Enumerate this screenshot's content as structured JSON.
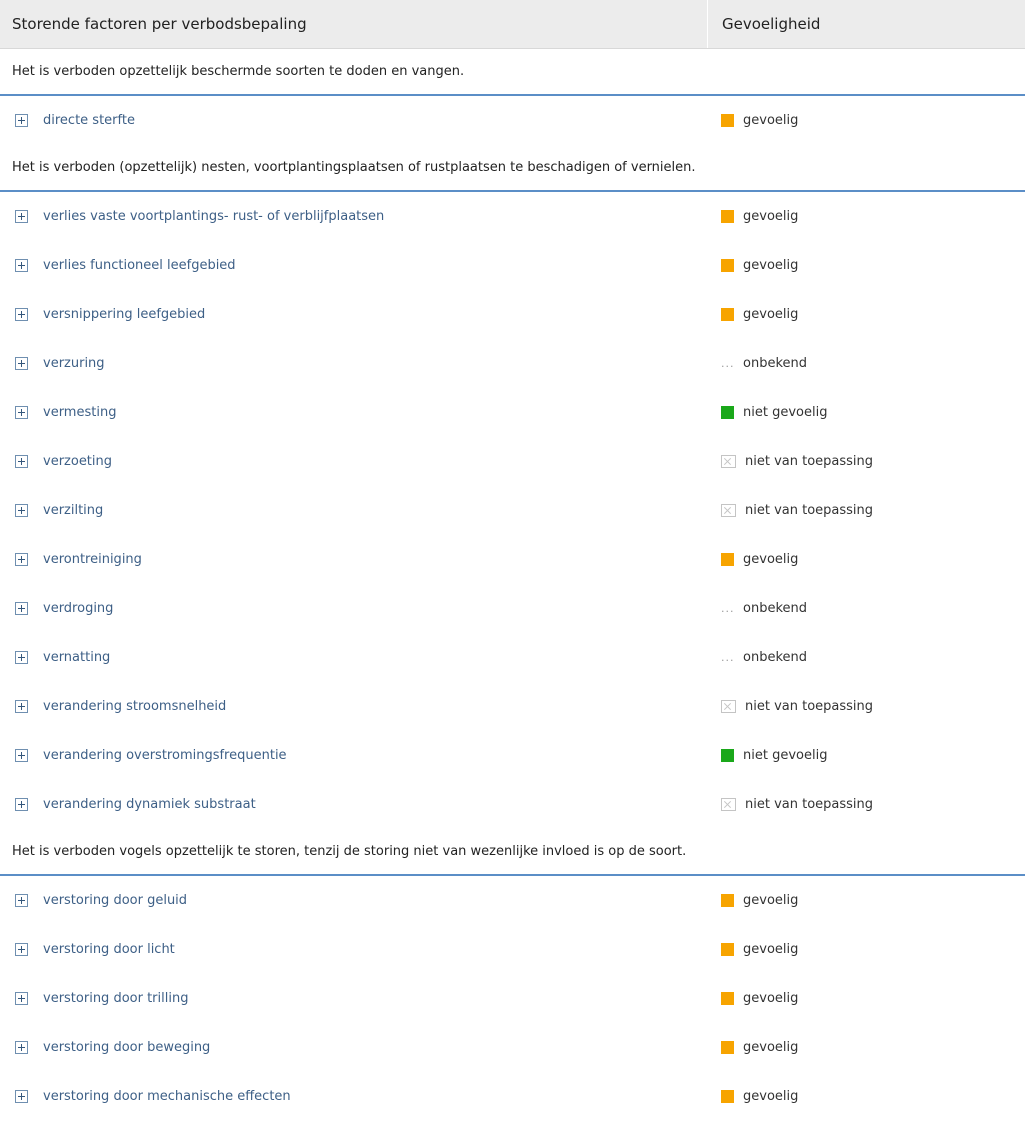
{
  "header": {
    "col_factor": "Storende factoren per verbodsbepaling",
    "col_sensitivity": "Gevoeligheid"
  },
  "legend_colors": {
    "gevoelig": "#f7a400",
    "niet_gevoelig": "#1aa81a"
  },
  "sections": [
    {
      "title": "Het is verboden opzettelijk beschermde soorten te doden en vangen.",
      "rows": [
        {
          "factor": "directe sterfte",
          "status": "gevoelig",
          "icon": "orange-square-icon"
        }
      ]
    },
    {
      "title": "Het is verboden (opzettelijk) nesten, voortplantingsplaatsen of rustplaatsen te beschadigen of vernielen.",
      "rows": [
        {
          "factor": "verlies vaste voortplantings- rust- of verblijfplaatsen",
          "status": "gevoelig",
          "icon": "orange-square-icon"
        },
        {
          "factor": "verlies functioneel leefgebied",
          "status": "gevoelig",
          "icon": "orange-square-icon"
        },
        {
          "factor": "versnippering leefgebied",
          "status": "gevoelig",
          "icon": "orange-square-icon"
        },
        {
          "factor": "verzuring",
          "status": "onbekend",
          "icon": "ellipsis-icon"
        },
        {
          "factor": "vermesting",
          "status": "niet gevoelig",
          "icon": "green-square-icon"
        },
        {
          "factor": "verzoeting",
          "status": "niet van toepassing",
          "icon": "crossed-box-icon"
        },
        {
          "factor": "verzilting",
          "status": "niet van toepassing",
          "icon": "crossed-box-icon"
        },
        {
          "factor": "verontreiniging",
          "status": "gevoelig",
          "icon": "orange-square-icon"
        },
        {
          "factor": "verdroging",
          "status": "onbekend",
          "icon": "ellipsis-icon"
        },
        {
          "factor": "vernatting",
          "status": "onbekend",
          "icon": "ellipsis-icon"
        },
        {
          "factor": "verandering stroomsnelheid",
          "status": "niet van toepassing",
          "icon": "crossed-box-icon"
        },
        {
          "factor": "verandering overstromingsfrequentie",
          "status": "niet gevoelig",
          "icon": "green-square-icon"
        },
        {
          "factor": "verandering dynamiek substraat",
          "status": "niet van toepassing",
          "icon": "crossed-box-icon"
        }
      ]
    },
    {
      "title": "Het is verboden vogels opzettelijk te storen, tenzij de storing niet van wezenlijke invloed is op de soort.",
      "rows": [
        {
          "factor": "verstoring door geluid",
          "status": "gevoelig",
          "icon": "orange-square-icon"
        },
        {
          "factor": "verstoring door licht",
          "status": "gevoelig",
          "icon": "orange-square-icon"
        },
        {
          "factor": "verstoring door trilling",
          "status": "gevoelig",
          "icon": "orange-square-icon"
        },
        {
          "factor": "verstoring door beweging",
          "status": "gevoelig",
          "icon": "orange-square-icon"
        },
        {
          "factor": "verstoring door mechanische effecten",
          "status": "gevoelig",
          "icon": "orange-square-icon"
        }
      ]
    }
  ],
  "onbekend_glyph": "..."
}
